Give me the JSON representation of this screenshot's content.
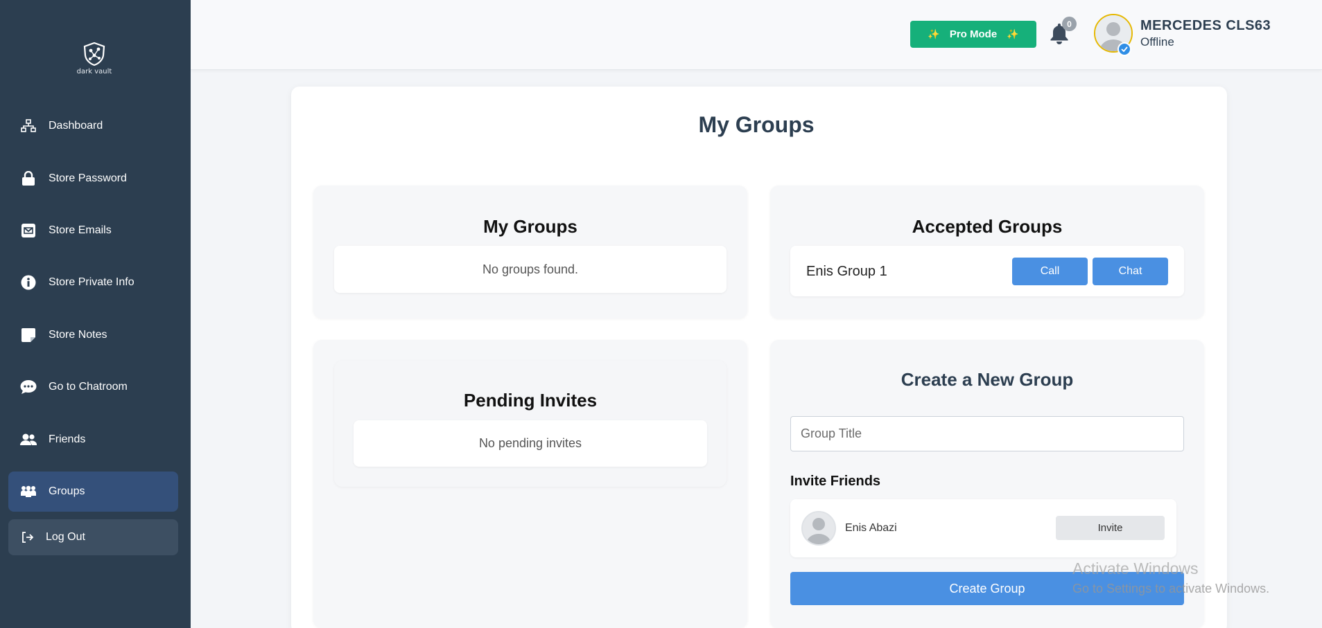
{
  "brand": {
    "logo_text": "dark vault"
  },
  "sidebar": {
    "items": [
      {
        "label": "Dashboard",
        "icon": "sitemap-icon"
      },
      {
        "label": "Store Password",
        "icon": "lock-icon"
      },
      {
        "label": "Store Emails",
        "icon": "envelope-icon"
      },
      {
        "label": "Store Private Info",
        "icon": "info-circle-icon"
      },
      {
        "label": "Store Notes",
        "icon": "sticky-note-icon"
      },
      {
        "label": "Go to Chatroom",
        "icon": "chat-bubble-icon"
      },
      {
        "label": "Friends",
        "icon": "users-icon"
      },
      {
        "label": "Groups",
        "icon": "groups-icon",
        "active": true
      }
    ],
    "logout_label": "Log Out"
  },
  "header": {
    "pro_mode_label": "Pro Mode",
    "notification_count": "0",
    "user_name": "MERCEDES CLS63",
    "user_status": "Offline"
  },
  "main": {
    "title": "My Groups",
    "my_groups": {
      "title": "My Groups",
      "empty_text": "No groups found."
    },
    "accepted_groups": {
      "title": "Accepted Groups",
      "items": [
        {
          "name": "Enis Group 1",
          "call_label": "Call",
          "chat_label": "Chat"
        }
      ]
    },
    "pending_invites": {
      "title": "Pending Invites",
      "empty_text": "No pending invites"
    },
    "create_group": {
      "title": "Create a New Group",
      "title_placeholder": "Group Title",
      "invite_friends_label": "Invite Friends",
      "friends": [
        {
          "name": "Enis Abazi",
          "invite_label": "Invite"
        }
      ],
      "create_button_label": "Create Group"
    }
  },
  "watermark": {
    "line1": "Activate Windows",
    "line2": "Go to Settings to activate Windows."
  },
  "colors": {
    "sidebar_bg": "#2c3e50",
    "active_item_bg": "#34507a",
    "pro_mode_green": "#16b07a",
    "primary_blue": "#4a90e2"
  }
}
